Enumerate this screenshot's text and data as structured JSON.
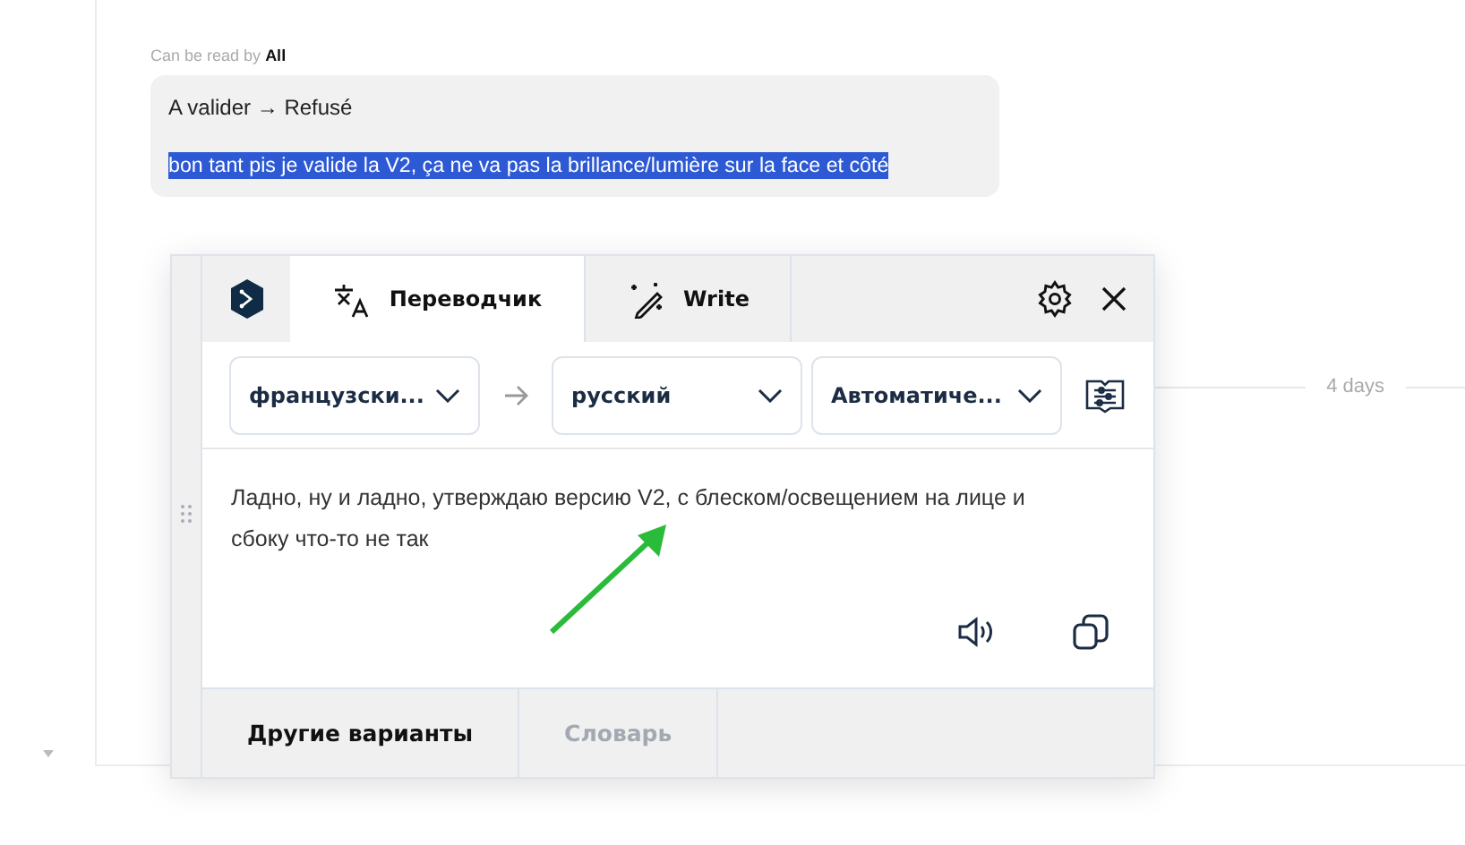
{
  "comment_visibility": {
    "prefix": "Can be read by",
    "audience": "All"
  },
  "comment": {
    "status_change": "A valider → Refusé",
    "message": "bon tant pis je valide la V2, ça ne va pas la brillance/lumière sur la face et côté",
    "message_highlighted": true
  },
  "timeline_label": "4 days",
  "translator": {
    "tabs": [
      {
        "label": "Переводчик",
        "kind": "translate",
        "selected": true
      },
      {
        "label": "Write",
        "kind": "write",
        "selected": false
      }
    ],
    "source_language": "французски...",
    "target_language": "русский",
    "formality": "Автоматиче...",
    "translation": "Ладно, ну и ладно, утверждаю версию V2, с блеском/освещением на лице и сбоку что-то не так",
    "bottom_tabs": [
      {
        "label": "Другие варианты",
        "selected": true
      },
      {
        "label": "Словарь",
        "selected": false
      }
    ]
  }
}
